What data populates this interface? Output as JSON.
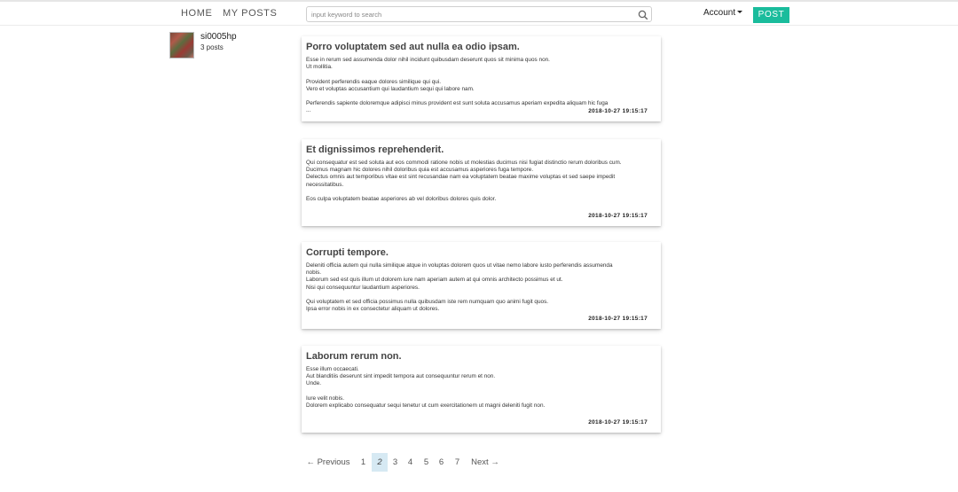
{
  "nav": {
    "home": "HOME",
    "my_posts": "MY POSTS",
    "search_placeholder": "input keyword to search",
    "account": "Account",
    "post_button": "POST"
  },
  "profile": {
    "username": "si0005hp",
    "post_count": "3 posts"
  },
  "posts": [
    {
      "title": "Porro voluptatem sed aut nulla ea odio ipsam.",
      "lines": [
        "Esse in rerum sed assumenda dolor nihil incidunt quibusdam deserunt quos sit minima quos non.",
        "Ut mollitia.",
        "",
        "Provident perferendis eaque dolores similique qui qui.",
        "Vero et voluptas accusantium qui laudantium sequi qui labore nam.",
        "",
        "Perferendis sapiente doloremque adipisci minus provident est sunt soluta accusamus aperiam expedita aliquam hic fuga",
        "..."
      ],
      "date": "2018-10-27 19:15:17"
    },
    {
      "title": "Et dignissimos reprehenderit.",
      "lines": [
        "Qui consequatur est sed soluta aut eos commodi ratione nobis ut molestias ducimus nisi fugiat distinctio rerum doloribus cum.",
        "Ducimus magnam hic dolores nihil doloribus quia est accusamus asperiores fuga tempore.",
        "Delectus omnis aut temporibus vitae est sint recusandae nam ea voluptatem beatae maxime voluptas et sed saepe impedit",
        "necessitatibus.",
        "",
        "Eos culpa voluptatem beatae asperiores ab vel doloribus dolores quis dolor."
      ],
      "date": "2018-10-27 19:15:17"
    },
    {
      "title": "Corrupti tempore.",
      "lines": [
        "Deleniti officia autem qui nulla similique atque in voluptas dolorem quos ut vitae nemo labore iusto perferendis assumenda",
        "nobis.",
        "Laborum sed est quis illum ut dolorem iure nam aperiam autem at qui omnis architecto possimus et ut.",
        "Nisi qui consequuntur laudantium asperiores.",
        "",
        "Qui voluptatem et sed officia possimus nulla quibusdam iste rem numquam quo animi fugit quos.",
        "Ipsa error nobis in ex consectetur aliquam ut dolores."
      ],
      "date": "2018-10-27 19:15:17"
    },
    {
      "title": "Laborum rerum non.",
      "lines": [
        "Esse illum occaecati.",
        "Aut blanditiis deserunt sint impedit tempora aut consequuntur rerum et non.",
        "Unde.",
        "",
        "Iure velit nobis.",
        "Dolorem explicabo consequatur sequi tenetur ut cum exercitationem ut magni deleniti fugit non."
      ],
      "date": "2018-10-27 19:15:17"
    }
  ],
  "pagination": {
    "previous": "← Previous",
    "pages": [
      "1",
      "2",
      "3",
      "4",
      "5",
      "6",
      "7"
    ],
    "current": "2",
    "next": "Next →"
  },
  "colors": {
    "accent": "#1abc9c",
    "pager_active": "#d6e9f3"
  },
  "icons": {
    "search": "search-icon",
    "account_caret": "caret-down-icon"
  }
}
